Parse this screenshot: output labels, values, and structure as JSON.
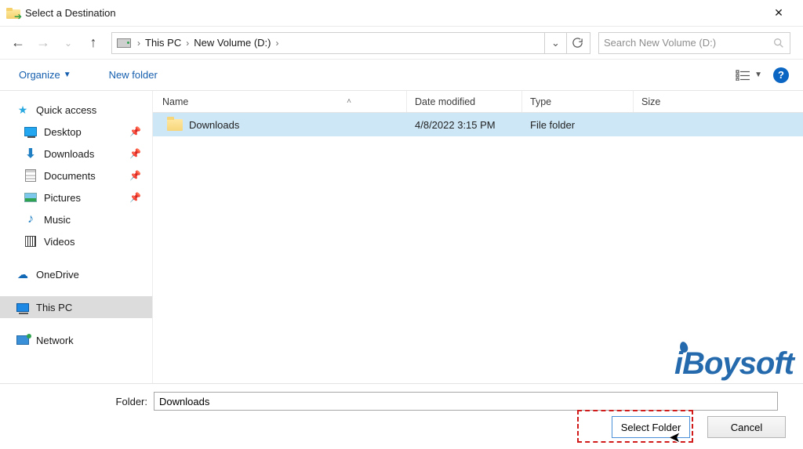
{
  "title": "Select a Destination",
  "breadcrumb": {
    "segments": [
      "This PC",
      "New Volume (D:)"
    ]
  },
  "search": {
    "placeholder": "Search New Volume (D:)"
  },
  "toolbar": {
    "organize": "Organize",
    "new_folder": "New folder",
    "help": "?"
  },
  "sidebar": {
    "quick_access": "Quick access",
    "items": [
      {
        "icon": "desktop",
        "label": "Desktop",
        "pinned": true
      },
      {
        "icon": "download",
        "label": "Downloads",
        "pinned": true
      },
      {
        "icon": "document",
        "label": "Documents",
        "pinned": true
      },
      {
        "icon": "pictures",
        "label": "Pictures",
        "pinned": true
      },
      {
        "icon": "music",
        "label": "Music",
        "pinned": false
      },
      {
        "icon": "videos",
        "label": "Videos",
        "pinned": false
      }
    ],
    "onedrive": "OneDrive",
    "this_pc": "This PC",
    "network": "Network"
  },
  "columns": {
    "name": "Name",
    "date": "Date modified",
    "type": "Type",
    "size": "Size"
  },
  "rows": [
    {
      "name": "Downloads",
      "date": "4/8/2022 3:15 PM",
      "type": "File folder",
      "size": ""
    }
  ],
  "folder_field": {
    "label": "Folder:",
    "value": "Downloads"
  },
  "buttons": {
    "select": "Select Folder",
    "cancel": "Cancel"
  },
  "watermark": "iBoysoft"
}
